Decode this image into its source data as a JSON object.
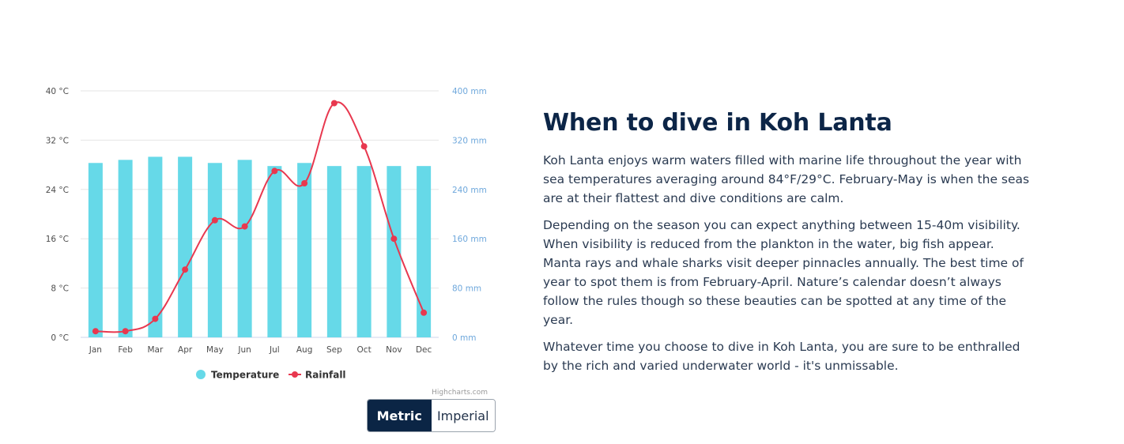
{
  "heading": "When to dive in Koh Lanta",
  "paragraphs": [
    "Koh Lanta enjoys warm waters filled with marine life throughout the year with sea temperatures averaging around 84°F/29°C. February-May is when the seas are at their flattest and dive conditions are calm.",
    "Depending on the season you can expect anything between 15-40m visibility. When visibility is reduced from the plankton in the water, big fish appear. Manta rays and whale sharks visit deeper pinnacles annually. The best time of year to spot them is from February-April. Nature’s calendar doesn’t always follow the rules though so these beauties can be spotted at any time of the year.",
    "Whatever time you choose to dive in Koh Lanta, you are sure to be enthralled by the rich and varied underwater world - it's unmissable."
  ],
  "unit_toggle": {
    "metric_label": "Metric",
    "imperial_label": "Imperial",
    "selected": "Metric"
  },
  "credits": "Highcharts.com",
  "colors": {
    "temperature": "#66d9e8",
    "rainfall": "#e8384f",
    "heading": "#0c2547",
    "toggle_active": "#0b2545"
  },
  "chart_data": {
    "type": "bar",
    "categories": [
      "Jan",
      "Feb",
      "Mar",
      "Apr",
      "May",
      "Jun",
      "Jul",
      "Aug",
      "Sep",
      "Oct",
      "Nov",
      "Dec"
    ],
    "series": [
      {
        "name": "Temperature",
        "type": "bar",
        "axis": "left",
        "values": [
          28.3,
          28.8,
          29.3,
          29.3,
          28.3,
          28.8,
          27.8,
          28.3,
          27.8,
          27.8,
          27.8,
          27.8
        ]
      },
      {
        "name": "Rainfall",
        "type": "line",
        "axis": "right",
        "values": [
          10,
          10,
          30,
          110,
          190,
          180,
          270,
          250,
          380,
          310,
          160,
          40
        ]
      }
    ],
    "y_left": {
      "ticks": [
        "0 °C",
        "8 °C",
        "16 °C",
        "24 °C",
        "32 °C",
        "40 °C"
      ],
      "range": [
        0,
        40
      ]
    },
    "y_right": {
      "ticks": [
        "0 mm",
        "80 mm",
        "160 mm",
        "240 mm",
        "320 mm",
        "400 mm"
      ],
      "range": [
        0,
        400
      ]
    },
    "legend": [
      "Temperature",
      "Rainfall"
    ],
    "legend_position": "bottom-center",
    "grid": true
  }
}
